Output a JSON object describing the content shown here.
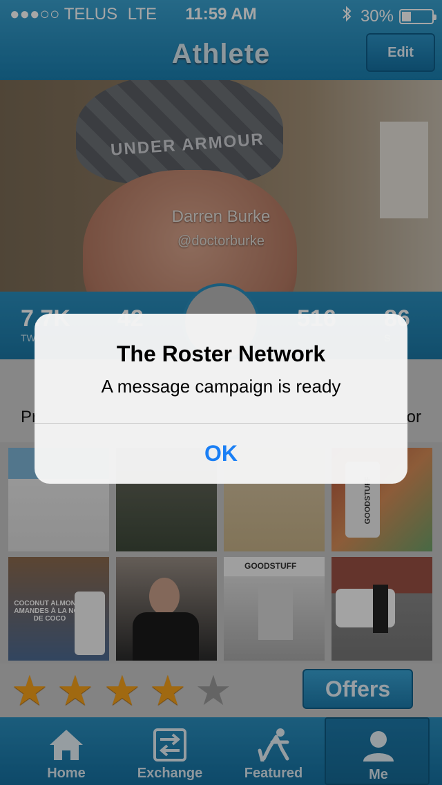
{
  "status_bar": {
    "carrier": "●●●○○ TELUS",
    "network": "LTE",
    "time": "11:59 AM",
    "bluetooth_icon": "bluetooth-icon",
    "battery": "30%",
    "battery_level": 0.3
  },
  "nav": {
    "title": "Athlete",
    "edit_label": "Edit"
  },
  "hero": {
    "cap_text": "UNDER ARMOUR",
    "name": "Darren Burke",
    "handle": "@doctorburke"
  },
  "stats": [
    {
      "value": "7.7K",
      "label": "TW"
    },
    {
      "value": "42",
      "label": ""
    },
    {
      "value": "516",
      "label": ""
    },
    {
      "value": "86",
      "label": "S"
    }
  ],
  "sponsor": {
    "left_text": "Pr",
    "right_text": "or"
  },
  "rating": {
    "stars_filled": 4,
    "stars_total": 5,
    "offers_label": "Offers"
  },
  "tabs": [
    {
      "label": "Home",
      "icon": "home-icon"
    },
    {
      "label": "Exchange",
      "icon": "exchange-icon"
    },
    {
      "label": "Featured",
      "icon": "hockey-player-icon"
    },
    {
      "label": "Me",
      "icon": "person-icon"
    }
  ],
  "photos": [
    {
      "label": "beach-photo"
    },
    {
      "label": "bottles-photo"
    },
    {
      "label": "sand-photo"
    },
    {
      "label": "goodstuff-bottle-photo"
    },
    {
      "label": "coconut-almonds-photo"
    },
    {
      "label": "man-holding-bottle-photo"
    },
    {
      "label": "goodstuff-tent-photo"
    },
    {
      "label": "jeep-photo"
    }
  ],
  "photo_texts": {
    "goodstuff_bottle": "GOODSTUFF",
    "coconut_line1": "COCONUT ALMONDS",
    "coconut_line2": "AMANDES À LA NOIX",
    "coconut_line3": "DE COCO",
    "tent_brand": "GOODSTUFF"
  },
  "alert": {
    "title": "The Roster Network",
    "message": "A message campaign is ready",
    "ok_label": "OK"
  }
}
